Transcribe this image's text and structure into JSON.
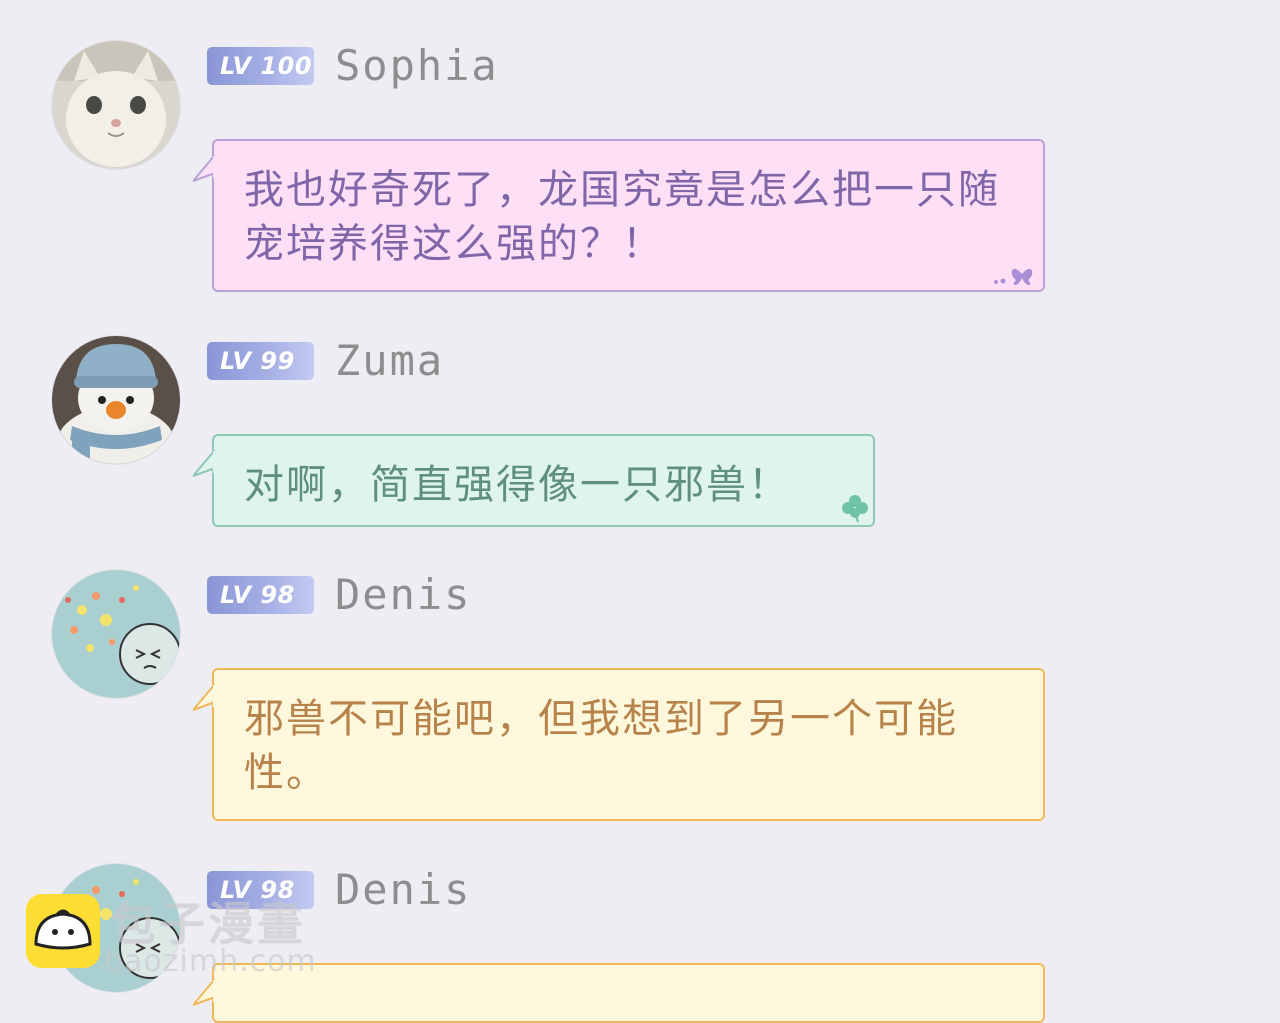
{
  "messages": [
    {
      "level": "LV 100",
      "name": "Sophia",
      "text": "我也好奇死了，龙国究竟是怎么把一只随宠培养得这么强的？！",
      "avatar_icon": "cat-avatar",
      "decoration_icon": "butterfly-icon",
      "theme": "pink"
    },
    {
      "level": "LV 99",
      "name": "Zuma",
      "text": "对啊，简直强得像一只邪兽！",
      "avatar_icon": "snowman-avatar",
      "decoration_icon": "clover-icon",
      "theme": "green"
    },
    {
      "level": "LV 98",
      "name": "Denis",
      "text": "邪兽不可能吧，但我想到了另一个可能性。",
      "avatar_icon": "doodle-face-avatar",
      "theme": "yellow"
    },
    {
      "level": "LV 98",
      "name": "Denis",
      "text": "",
      "avatar_icon": "doodle-face-avatar",
      "theme": "yellow"
    }
  ],
  "watermark": {
    "logo_icon": "bun-logo-icon",
    "text": "包子漫畫",
    "url": "baozimh.com"
  },
  "colors": {
    "background": "#ededf3",
    "level_badge": "#8a95d6",
    "pink_bubble": "#ffdff6",
    "green_bubble": "#dff4ed",
    "yellow_bubble": "#fff8dd"
  }
}
